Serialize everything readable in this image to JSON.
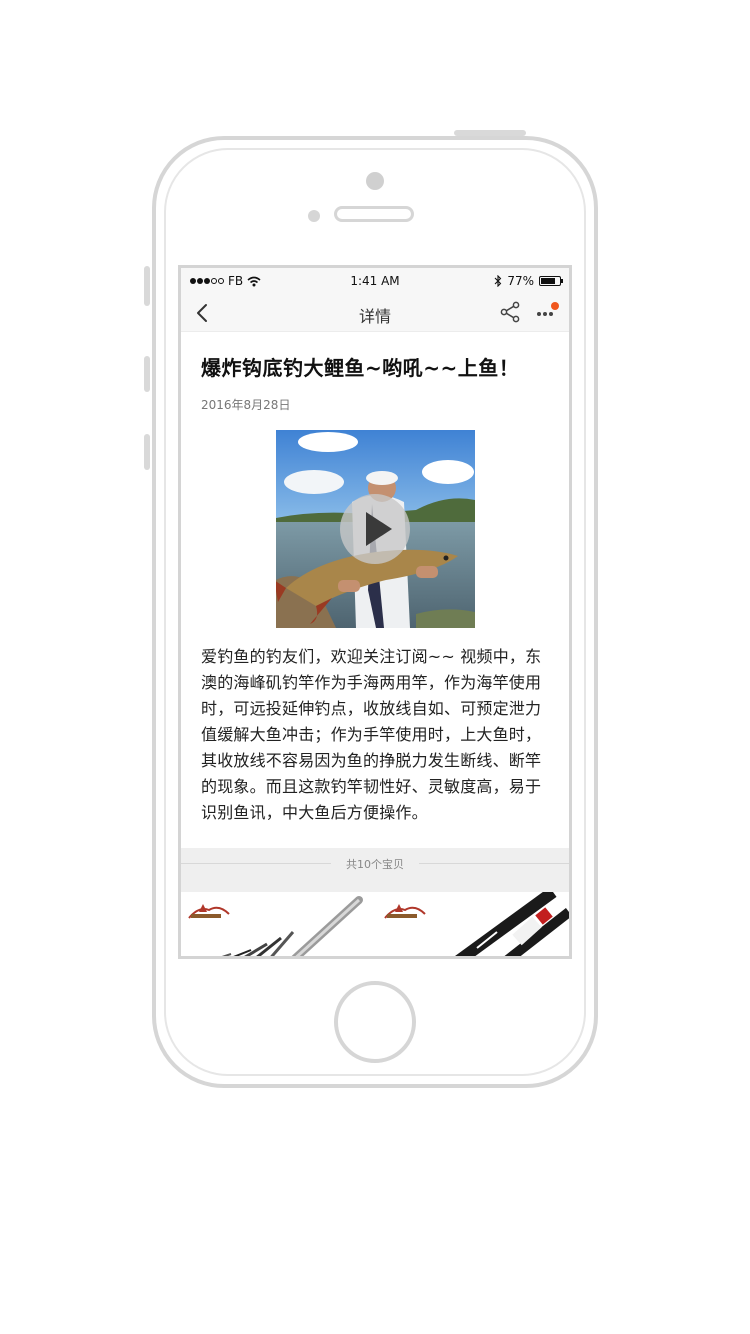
{
  "status_bar": {
    "carrier": "FB",
    "time": "1:41 AM",
    "battery": "77%",
    "battery_level": 0.77
  },
  "nav": {
    "title": "详情",
    "back_icon": "chevron-left-icon",
    "share_icon": "share-icon",
    "more_icon": "more-dots-icon",
    "badge_color": "#f0561d"
  },
  "article": {
    "title": "爆炸钩底钓大鲤鱼~哟吼~~上鱼！",
    "date": "2016年8月28日",
    "video_icon": "play-icon",
    "body": "爱钓鱼的钓友们，欢迎关注订阅~~ 视频中，东澳的海峰矶钓竿作为手海两用竿，作为海竿使用时，可远投延伸钓点，收放线自如、可预定泄力值缓解大鱼冲击；作为手竿使用时，上大鱼时，其收放线不容易因为鱼的挣脱力发生断线、断竿的现象。而且这款钓竿韧性好、灵敏度高，易于识别鱼讯，中大鱼后方便操作。"
  },
  "products": {
    "count_label": "共10个宝贝"
  }
}
